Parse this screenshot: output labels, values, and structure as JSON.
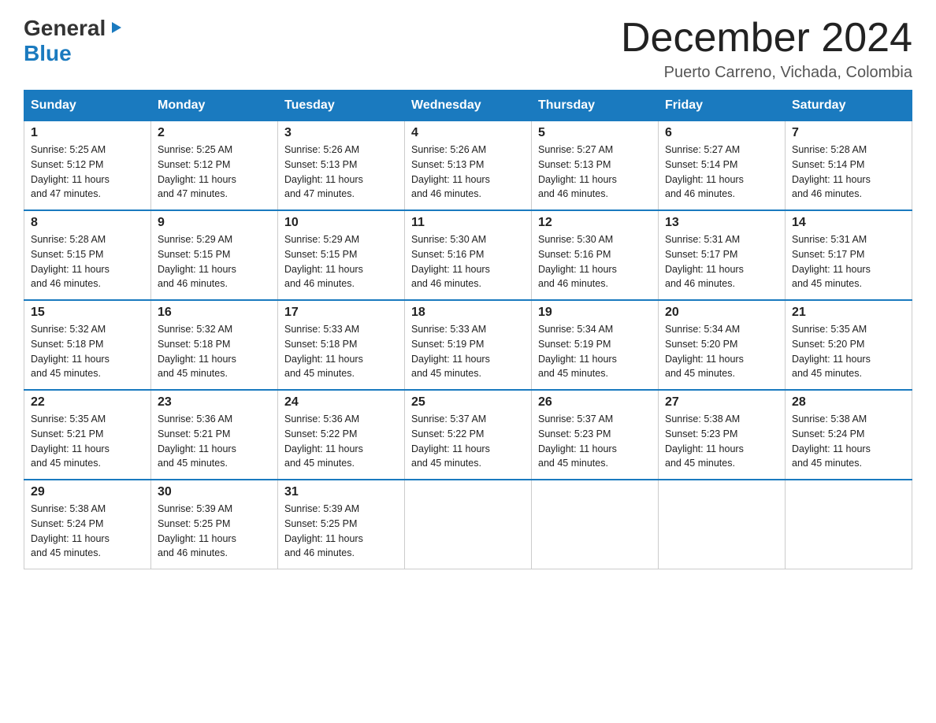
{
  "logo": {
    "general": "General",
    "blue": "Blue",
    "triangle": "▶"
  },
  "header": {
    "month_year": "December 2024",
    "location": "Puerto Carreno, Vichada, Colombia"
  },
  "weekdays": [
    "Sunday",
    "Monday",
    "Tuesday",
    "Wednesday",
    "Thursday",
    "Friday",
    "Saturday"
  ],
  "weeks": [
    [
      {
        "day": "1",
        "sunrise": "5:25 AM",
        "sunset": "5:12 PM",
        "daylight": "11 hours and 47 minutes."
      },
      {
        "day": "2",
        "sunrise": "5:25 AM",
        "sunset": "5:12 PM",
        "daylight": "11 hours and 47 minutes."
      },
      {
        "day": "3",
        "sunrise": "5:26 AM",
        "sunset": "5:13 PM",
        "daylight": "11 hours and 47 minutes."
      },
      {
        "day": "4",
        "sunrise": "5:26 AM",
        "sunset": "5:13 PM",
        "daylight": "11 hours and 46 minutes."
      },
      {
        "day": "5",
        "sunrise": "5:27 AM",
        "sunset": "5:13 PM",
        "daylight": "11 hours and 46 minutes."
      },
      {
        "day": "6",
        "sunrise": "5:27 AM",
        "sunset": "5:14 PM",
        "daylight": "11 hours and 46 minutes."
      },
      {
        "day": "7",
        "sunrise": "5:28 AM",
        "sunset": "5:14 PM",
        "daylight": "11 hours and 46 minutes."
      }
    ],
    [
      {
        "day": "8",
        "sunrise": "5:28 AM",
        "sunset": "5:15 PM",
        "daylight": "11 hours and 46 minutes."
      },
      {
        "day": "9",
        "sunrise": "5:29 AM",
        "sunset": "5:15 PM",
        "daylight": "11 hours and 46 minutes."
      },
      {
        "day": "10",
        "sunrise": "5:29 AM",
        "sunset": "5:15 PM",
        "daylight": "11 hours and 46 minutes."
      },
      {
        "day": "11",
        "sunrise": "5:30 AM",
        "sunset": "5:16 PM",
        "daylight": "11 hours and 46 minutes."
      },
      {
        "day": "12",
        "sunrise": "5:30 AM",
        "sunset": "5:16 PM",
        "daylight": "11 hours and 46 minutes."
      },
      {
        "day": "13",
        "sunrise": "5:31 AM",
        "sunset": "5:17 PM",
        "daylight": "11 hours and 46 minutes."
      },
      {
        "day": "14",
        "sunrise": "5:31 AM",
        "sunset": "5:17 PM",
        "daylight": "11 hours and 45 minutes."
      }
    ],
    [
      {
        "day": "15",
        "sunrise": "5:32 AM",
        "sunset": "5:18 PM",
        "daylight": "11 hours and 45 minutes."
      },
      {
        "day": "16",
        "sunrise": "5:32 AM",
        "sunset": "5:18 PM",
        "daylight": "11 hours and 45 minutes."
      },
      {
        "day": "17",
        "sunrise": "5:33 AM",
        "sunset": "5:18 PM",
        "daylight": "11 hours and 45 minutes."
      },
      {
        "day": "18",
        "sunrise": "5:33 AM",
        "sunset": "5:19 PM",
        "daylight": "11 hours and 45 minutes."
      },
      {
        "day": "19",
        "sunrise": "5:34 AM",
        "sunset": "5:19 PM",
        "daylight": "11 hours and 45 minutes."
      },
      {
        "day": "20",
        "sunrise": "5:34 AM",
        "sunset": "5:20 PM",
        "daylight": "11 hours and 45 minutes."
      },
      {
        "day": "21",
        "sunrise": "5:35 AM",
        "sunset": "5:20 PM",
        "daylight": "11 hours and 45 minutes."
      }
    ],
    [
      {
        "day": "22",
        "sunrise": "5:35 AM",
        "sunset": "5:21 PM",
        "daylight": "11 hours and 45 minutes."
      },
      {
        "day": "23",
        "sunrise": "5:36 AM",
        "sunset": "5:21 PM",
        "daylight": "11 hours and 45 minutes."
      },
      {
        "day": "24",
        "sunrise": "5:36 AM",
        "sunset": "5:22 PM",
        "daylight": "11 hours and 45 minutes."
      },
      {
        "day": "25",
        "sunrise": "5:37 AM",
        "sunset": "5:22 PM",
        "daylight": "11 hours and 45 minutes."
      },
      {
        "day": "26",
        "sunrise": "5:37 AM",
        "sunset": "5:23 PM",
        "daylight": "11 hours and 45 minutes."
      },
      {
        "day": "27",
        "sunrise": "5:38 AM",
        "sunset": "5:23 PM",
        "daylight": "11 hours and 45 minutes."
      },
      {
        "day": "28",
        "sunrise": "5:38 AM",
        "sunset": "5:24 PM",
        "daylight": "11 hours and 45 minutes."
      }
    ],
    [
      {
        "day": "29",
        "sunrise": "5:38 AM",
        "sunset": "5:24 PM",
        "daylight": "11 hours and 45 minutes."
      },
      {
        "day": "30",
        "sunrise": "5:39 AM",
        "sunset": "5:25 PM",
        "daylight": "11 hours and 46 minutes."
      },
      {
        "day": "31",
        "sunrise": "5:39 AM",
        "sunset": "5:25 PM",
        "daylight": "11 hours and 46 minutes."
      },
      null,
      null,
      null,
      null
    ]
  ],
  "labels": {
    "sunrise": "Sunrise:",
    "sunset": "Sunset:",
    "daylight": "Daylight:"
  }
}
